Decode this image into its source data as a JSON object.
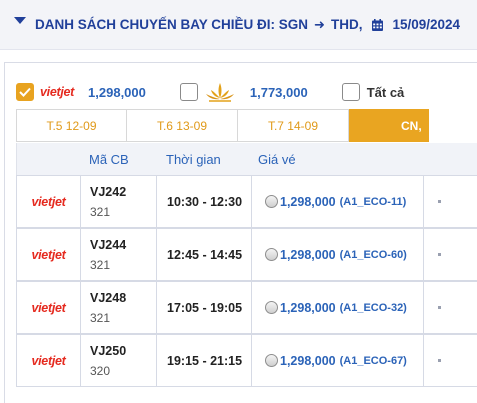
{
  "header": {
    "title": "DANH SÁCH CHUYẾN BAY CHIỀU ĐI: SGN",
    "destination": "THD,",
    "date": "15/09/2024",
    "icons": [
      "caret-down-icon",
      "arrow-right-icon",
      "calendar-icon"
    ]
  },
  "filters": {
    "vietjet": {
      "logo_text": "vietjet",
      "price": "1,298,000",
      "checked": true
    },
    "vietnam_airlines": {
      "price": "1,773,000",
      "checked": false
    },
    "all": {
      "label": "Tất cả",
      "checked": false
    }
  },
  "tabs": [
    {
      "label": "T.5 12-09",
      "active": false
    },
    {
      "label": "T.6 13-09",
      "active": false
    },
    {
      "label": "T.7 14-09",
      "active": false
    },
    {
      "label": "CN,",
      "active": true
    }
  ],
  "table": {
    "headers": {
      "code": "Mã CB",
      "time": "Thời gian",
      "price": "Giá vé"
    },
    "rows": [
      {
        "logo": "vietjet",
        "flight": "VJ242",
        "aircraft": "321",
        "time": "10:30 - 12:30",
        "price": "1,298,000",
        "fare_class": "(A1_ECO-11)"
      },
      {
        "logo": "vietjet",
        "flight": "VJ244",
        "aircraft": "321",
        "time": "12:45 - 14:45",
        "price": "1,298,000",
        "fare_class": "(A1_ECO-60)"
      },
      {
        "logo": "vietjet",
        "flight": "VJ248",
        "aircraft": "321",
        "time": "17:05 - 19:05",
        "price": "1,298,000",
        "fare_class": "(A1_ECO-32)"
      },
      {
        "logo": "vietjet",
        "flight": "VJ250",
        "aircraft": "320",
        "time": "19:15 - 21:15",
        "price": "1,298,000",
        "fare_class": "(A1_ECO-67)"
      }
    ]
  },
  "colors": {
    "header_text": "#21409a",
    "accent_orange": "#e9a521",
    "price_blue": "#2b63b8",
    "vietjet_red": "#e52a1f"
  }
}
